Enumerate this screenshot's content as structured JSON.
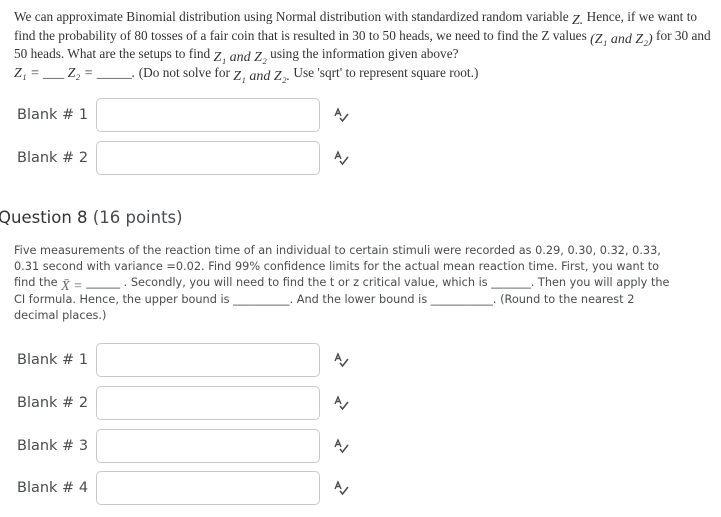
{
  "question7": {
    "line1_a": "We can approximate Binomial distribution using Normal distribution with standardized random variable ",
    "z_var": "Z.",
    "line1_b": " Hence, if we want to find the probability of 80 tosses of a fair coin that is resulted in 30 to 50 heads, we need to find the Z values ",
    "z1z2_paren": "(Z₁ and Z₂)",
    "line3_a": " for 30 and 50 heads.  What are the setups to find ",
    "z1z2": "Z₁ and Z₂",
    "line3_b": " using the information given above?",
    "line4_a": "Z₁ = ___ Z₂ = _____. ",
    "line4_b": "(Do not solve for ",
    "z1z2_dot": "Z₁ and Z₂.",
    "line4_c": " Use 'sqrt' to represent square root.)",
    "blanks": [
      {
        "label": "Blank # 1",
        "value": ""
      },
      {
        "label": "Blank # 2",
        "value": ""
      }
    ]
  },
  "question8": {
    "title": "Question 8",
    "points": "(16 points)",
    "text_a": "Five measurements of the reaction time of an individual to certain stimuli were recorded as 0.29, 0.30, 0.32, 0.33, 0.31 second with variance =0.02. Find 99% confidence limits for the actual mean reaction time.  First, you want to find the ",
    "xbar": "X̄ = ",
    "text_b": "______ .  Secondly, you will need to find the t or z critical value, which is _______.  Then you will apply the CI formula.  Hence, the upper bound is __________.  And the lower bound is ___________. (Round to the nearest 2 decimal places.)",
    "blanks": [
      {
        "label": "Blank # 1",
        "value": ""
      },
      {
        "label": "Blank # 2",
        "value": ""
      },
      {
        "label": "Blank # 3",
        "value": ""
      },
      {
        "label": "Blank # 4",
        "value": ""
      }
    ]
  },
  "icons": {
    "spellcheck": "spellcheck-icon"
  }
}
